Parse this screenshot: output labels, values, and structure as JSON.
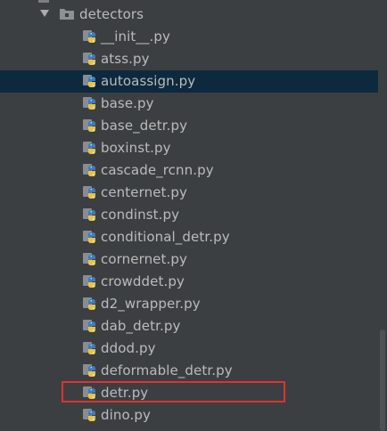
{
  "folder": {
    "name": "detectors",
    "expanded": true
  },
  "files": [
    {
      "name": "__init__.py"
    },
    {
      "name": "atss.py"
    },
    {
      "name": "autoassign.py",
      "selected": true
    },
    {
      "name": "base.py"
    },
    {
      "name": "base_detr.py"
    },
    {
      "name": "boxinst.py"
    },
    {
      "name": "cascade_rcnn.py"
    },
    {
      "name": "centernet.py"
    },
    {
      "name": "condinst.py"
    },
    {
      "name": "conditional_detr.py"
    },
    {
      "name": "cornernet.py"
    },
    {
      "name": "crowddet.py"
    },
    {
      "name": "d2_wrapper.py"
    },
    {
      "name": "dab_detr.py"
    },
    {
      "name": "ddod.py"
    },
    {
      "name": "deformable_detr.py"
    },
    {
      "name": "detr.py",
      "highlighted": true
    },
    {
      "name": "dino.py"
    }
  ],
  "colors": {
    "background": "#3c3f41",
    "selection": "#0d293e",
    "highlight_box": "#e0312f",
    "text": "#bbbbbb"
  },
  "icons": {
    "folder": "folder-icon",
    "file": "python-file-icon",
    "chevron": "chevron-down-icon"
  }
}
